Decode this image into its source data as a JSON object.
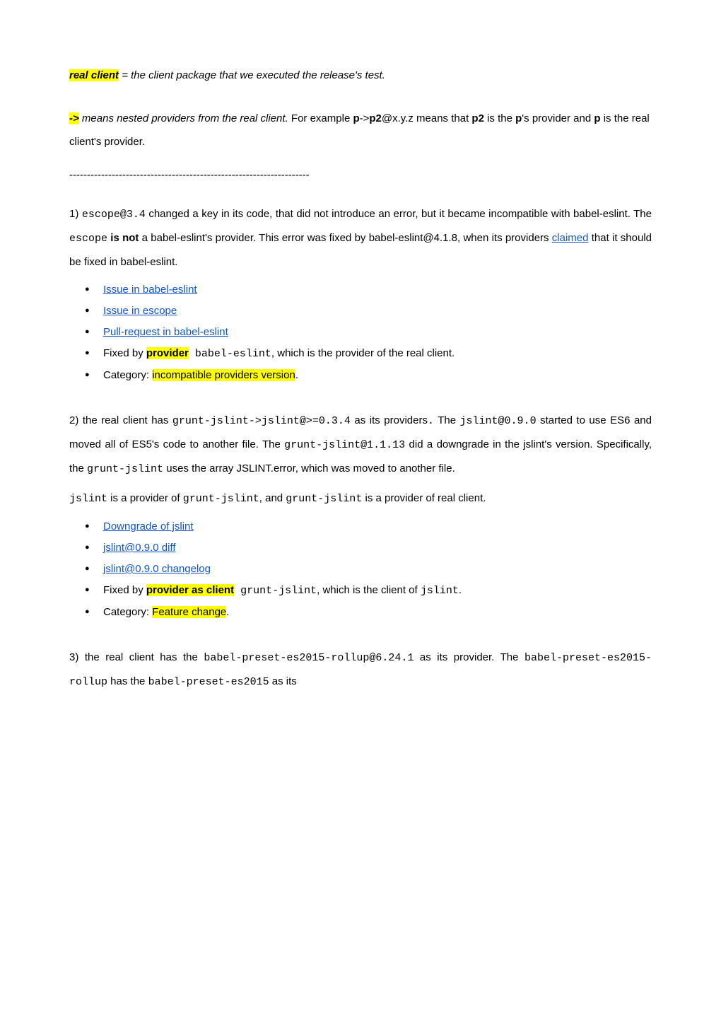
{
  "definitions": {
    "real_client_label": "real client",
    "real_client_def": " = the client package that we executed the release's test.",
    "arrow_label": "->",
    "arrow_def_prefix": " means nested providers from the real client.",
    "arrow_def_example_prefix": " For example ",
    "arrow_p": "p",
    "arrow_gt": "->",
    "arrow_p2": "p2",
    "arrow_suffix": "@x.y.z means that ",
    "arrow_line2_p2": "p2",
    "arrow_line2_mid": " is the ",
    "arrow_line2_p": "p",
    "arrow_line2_after_p": "'s provider and ",
    "arrow_line2_p_again": "p",
    "arrow_line2_end": " is the real client's provider."
  },
  "divider": "--------------------------------------------------------------------",
  "items": [
    {
      "num": "1) ",
      "body_parts": [
        {
          "code": "escope@3.4"
        },
        " changed a key in its code, that did not introduce an error, but it became incompatible with babel-eslint. The ",
        {
          "code": "escope"
        },
        " ",
        {
          "bold": "is not"
        },
        " a babel-eslint's provider. This error was fixed by babel-eslint@4.1.8, when its providers ",
        {
          "link": "claimed"
        },
        " that it should be fixed in babel-eslint."
      ],
      "bullets": [
        {
          "link": "Issue in babel-eslint"
        },
        {
          "link": "Issue in escope"
        },
        {
          "link": "Pull-request in babel-eslint"
        },
        {
          "fixed_by_prefix": "Fixed by ",
          "fixed_by_highlight": "provider",
          "fixed_by_code": " babel-eslint",
          "fixed_by_suffix": ", which is the provider of the real client."
        },
        {
          "category_prefix": "Category: ",
          "category_highlight": "incompatible providers version",
          "category_suffix": "."
        }
      ]
    },
    {
      "num": "2) ",
      "body_parts": [
        "the real client has ",
        {
          "code": "grunt-jslint->jslint@>=0.3.4"
        },
        " as its providers",
        {
          "code": "."
        },
        " The ",
        {
          "code": "jslint@0.9.0"
        },
        " started to use ES6 and moved all of ES5's code to another file. The ",
        {
          "code": "grunt-jslint@1.1.13"
        },
        " did a downgrade in the jslint's version. Specifically, the ",
        {
          "code": "grunt-jslint"
        },
        " uses the array JSLINT.error, which was moved to another file."
      ],
      "body2_parts": [
        {
          "code": "jslint"
        },
        " is a provider of ",
        {
          "code": "grunt-jslint"
        },
        ", and ",
        {
          "code": "grunt-jslint"
        },
        " is a provider of real client."
      ],
      "bullets": [
        {
          "link": "Downgrade of jslint"
        },
        {
          "link": "jslint@0.9.0 diff"
        },
        {
          "link": "jslint@0.9.0 changelog"
        },
        {
          "fixed_by_prefix": "Fixed by ",
          "fixed_by_highlight": "provider as client",
          "fixed_by_code": " grunt-jslint",
          "fixed_by_suffix": ", which is the client of ",
          "fixed_by_code2": "jslint",
          "fixed_by_suffix2": "."
        },
        {
          "category_prefix": "Category: ",
          "category_highlight": "Feature change",
          "category_suffix": "."
        }
      ]
    },
    {
      "num": "3) ",
      "body_parts": [
        "the real client has the ",
        {
          "code": "babel-preset-es2015-rollup@6.24.1"
        },
        " as its provider. The ",
        {
          "code": "babel-preset-es2015-rollup"
        },
        " has the ",
        {
          "code": "babel-preset-es2015"
        },
        " as its"
      ]
    }
  ]
}
